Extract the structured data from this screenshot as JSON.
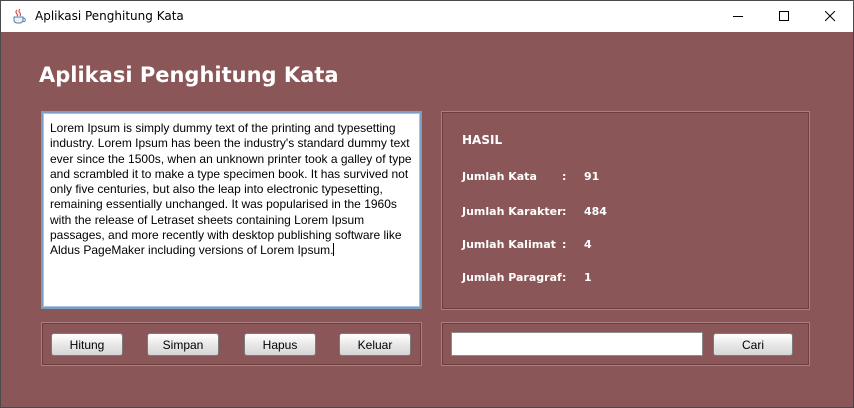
{
  "window": {
    "title": "Aplikasi Penghitung Kata",
    "app_icon": "java-coffee-cup-icon",
    "controls": [
      "minimize-icon",
      "maximize-icon",
      "close-icon"
    ]
  },
  "main": {
    "heading": "Aplikasi Penghitung Kata",
    "input_text": "Lorem Ipsum is simply dummy text of the printing and typesetting industry. Lorem Ipsum has been the industry's standard dummy text ever since the 1500s, when an unknown printer took a galley of type and scrambled it to make a type specimen book. It has survived not only five centuries, but also the leap into electronic typesetting, remaining essentially unchanged. It was popularised in the 1960s with the release of Letraset sheets containing Lorem Ipsum passages, and more recently with desktop publishing software like Aldus PageMaker including versions of Lorem Ipsum."
  },
  "hasil": {
    "title": "HASIL",
    "stats": [
      {
        "label": "Jumlah Kata",
        "separator": ":",
        "value": "91"
      },
      {
        "label": "Jumlah Karakter",
        "separator": ":",
        "value": "484"
      },
      {
        "label": "Jumlah Kalimat",
        "separator": ":",
        "value": "4"
      },
      {
        "label": "Jumlah Paragraf",
        "separator": ":",
        "value": "1"
      }
    ]
  },
  "buttons": {
    "hitung": "Hitung",
    "simpan": "Simpan",
    "hapus": "Hapus",
    "keluar": "Keluar"
  },
  "search": {
    "value": "",
    "button": "Cari"
  },
  "colors": {
    "background": "#8b5658",
    "panel_border": "#a97f81",
    "text_area_border": "#7b9ec4"
  }
}
